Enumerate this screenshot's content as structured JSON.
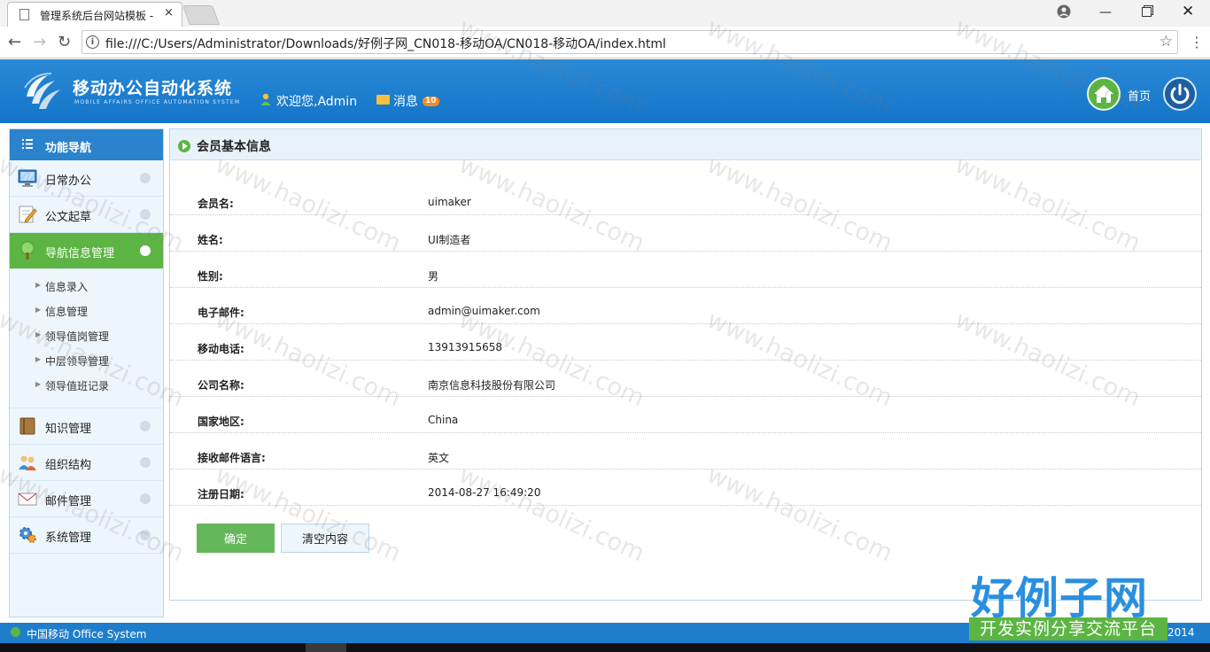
{
  "browser": {
    "tab_title": "管理系统后台网站模板 -",
    "tab_close": "×",
    "url": "file:///C:/Users/Administrator/Downloads/好例子网_CN018-移动OA/CN018-移动OA/index.html",
    "info": "i",
    "star": "☆",
    "menu": "⋮",
    "back": "←",
    "forward": "→",
    "reload": "↻",
    "minimize": "—",
    "close": "✕"
  },
  "header": {
    "title": "移动办公自动化系统",
    "subtitle": "MOBILE AFFAIRS OFFICE AUTOMATION SYSTEM",
    "welcome": "欢迎您,Admin",
    "messages_label": "消息",
    "messages_count": "10",
    "home_label": "首页"
  },
  "sidebar": {
    "title": "功能导航",
    "items": [
      {
        "label": "日常办公",
        "icon": "monitor-icon"
      },
      {
        "label": "公文起草",
        "icon": "pencil-icon"
      },
      {
        "label": "导航信息管理",
        "icon": "tree-icon"
      },
      {
        "label": "知识管理",
        "icon": "book-icon"
      },
      {
        "label": "组织结构",
        "icon": "people-icon"
      },
      {
        "label": "邮件管理",
        "icon": "mail-icon"
      },
      {
        "label": "系统管理",
        "icon": "gear-icon"
      }
    ],
    "subitems": [
      "信息录入",
      "信息管理",
      "领导值岗管理",
      "中层领导管理",
      "领导值班记录"
    ],
    "sub_arrow": "▶"
  },
  "main": {
    "title": "会员基本信息",
    "fields": [
      {
        "label": "会员名:",
        "value": "uimaker"
      },
      {
        "label": "姓名:",
        "value": "UI制造者"
      },
      {
        "label": "性别:",
        "value": "男"
      },
      {
        "label": "电子邮件:",
        "value": "admin@uimaker.com"
      },
      {
        "label": "移动电话:",
        "value": "13913915658"
      },
      {
        "label": "公司名称:",
        "value": "南京信息科技股份有限公司"
      },
      {
        "label": "国家地区:",
        "value": "China"
      },
      {
        "label": "接收邮件语言:",
        "value": "英文"
      },
      {
        "label": "注册日期:",
        "value": "2014-08-27 16:49:20"
      }
    ],
    "confirm_label": "确定",
    "clear_label": "清空内容"
  },
  "footer": {
    "text": "中国移动  Office System",
    "year": "2014"
  },
  "watermark": {
    "text": "www.haolizi.com",
    "logo_big": "好例子网",
    "logo_small": "开发实例分享交流平台"
  },
  "colors": {
    "header_blue": "#1474c8",
    "active_green": "#5cb543",
    "sidebar_bg": "#eef6fd",
    "badge_orange": "#f28c23"
  }
}
